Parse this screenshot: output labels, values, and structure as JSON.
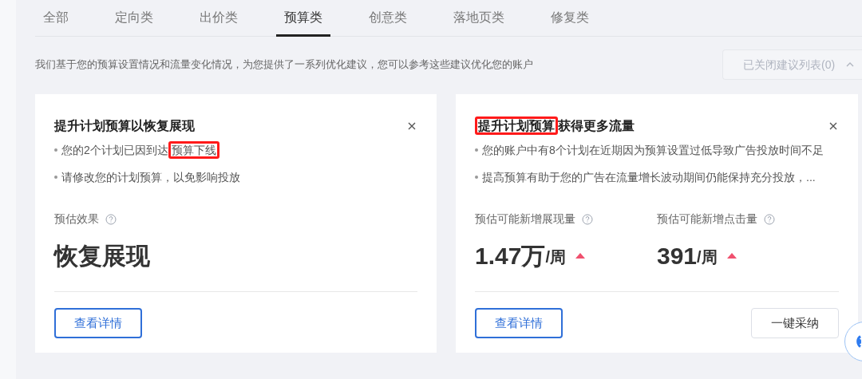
{
  "tabs": [
    {
      "label": "全部",
      "selected": false
    },
    {
      "label": "定向类",
      "selected": false
    },
    {
      "label": "出价类",
      "selected": false
    },
    {
      "label": "预算类",
      "selected": true
    },
    {
      "label": "创意类",
      "selected": false
    },
    {
      "label": "落地页类",
      "selected": false
    },
    {
      "label": "修复类",
      "selected": false
    }
  ],
  "description": "我们基于您的预算设置情况和流量变化情况，为您提供了一系列优化建议，您可以参考这些建议优化您的账户",
  "closed_list_button": {
    "label": "已关闭建议列表(0)",
    "expanded": true
  },
  "cards": [
    {
      "title": [
        {
          "text": "提升计划预算以恢复展现",
          "highlighted": false
        }
      ],
      "bullets": [
        [
          {
            "text": "您的2个计划已因到达",
            "highlighted": false
          },
          {
            "text": "预算下线",
            "highlighted": true
          }
        ],
        [
          {
            "text": "请修改您的计划预算，以免影响投放",
            "highlighted": false
          }
        ]
      ],
      "metrics": [
        {
          "label": "预估效果",
          "value": "恢复展现",
          "trend_up": false
        }
      ],
      "buttons": [
        {
          "label": "查看详情",
          "kind": "primary-outline"
        }
      ]
    },
    {
      "title": [
        {
          "text": "提升计划预算",
          "highlighted": true
        },
        {
          "text": "获得更多流量",
          "highlighted": false
        }
      ],
      "bullets": [
        [
          {
            "text": "您的账户中有8个计划在近期因为预算设置过低导致广告投放时间不足",
            "highlighted": false
          }
        ],
        [
          {
            "text": "提高预算有助于您的广告在流量增长波动期间仍能保持充分投放，...",
            "highlighted": false
          }
        ]
      ],
      "metrics": [
        {
          "label": "预估可能新增展现量",
          "value": "1.47万",
          "unit": "/周",
          "trend_up": true
        },
        {
          "label": "预估可能新增点击量",
          "value": "391",
          "unit": "/周",
          "trend_up": true
        }
      ],
      "buttons": [
        {
          "label": "查看详情",
          "kind": "primary-outline"
        },
        {
          "label": "一键采纳",
          "kind": "default"
        }
      ]
    }
  ]
}
